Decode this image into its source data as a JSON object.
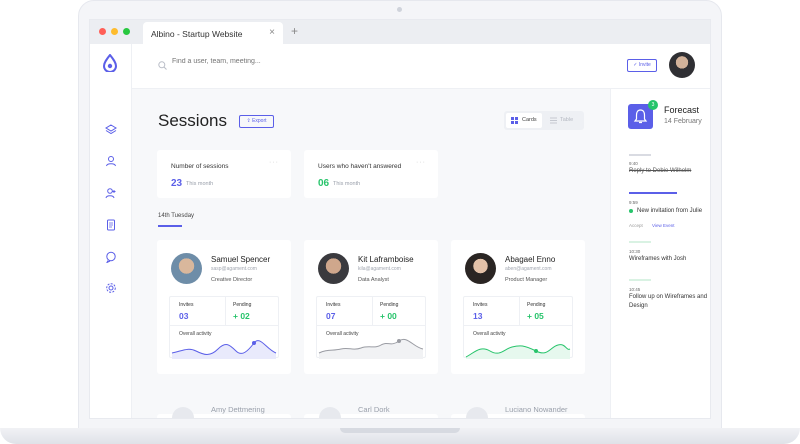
{
  "browser": {
    "tab_title": "Albino - Startup Website",
    "tab_close": "×",
    "new_tab": "+"
  },
  "topbar": {
    "search_placeholder": "Find a user, team, meeting...",
    "invite_label": "Invite"
  },
  "main": {
    "title": "Sessions",
    "export_label": "Export",
    "view_toggle": {
      "cards": "Cards",
      "table": "Table"
    },
    "stats": [
      {
        "label": "Number of sessions",
        "value": "23",
        "sub": "This month",
        "color": "#5b5fe8"
      },
      {
        "label": "Users  who haven't answered",
        "value": "06",
        "sub": "This month",
        "color": "#27c46b"
      }
    ],
    "date_label": "14th Tuesday",
    "cards": [
      {
        "name": "Samuel Spencer",
        "email": "sasp@agament.com",
        "role": "Creative Director",
        "invites_label": "Invites",
        "invites": "03",
        "pending_label": "Pending",
        "pending": "+ 02",
        "activity_label": "Overall activity",
        "chart_color": "#5b5fe8"
      },
      {
        "name": "Kit Laframboise",
        "email": "kila@agament.com",
        "role": "Data Analyst",
        "invites_label": "Invites",
        "invites": "07",
        "pending_label": "Pending",
        "pending": "+ 00",
        "activity_label": "Overall activity",
        "chart_color": "#9a9ca3"
      },
      {
        "name": "Abagael Enno",
        "email": "aben@agament.com",
        "role": "Product Manager",
        "invites_label": "Invites",
        "invites": "13",
        "pending_label": "Pending",
        "pending": "+ 05",
        "activity_label": "Overall activity",
        "chart_color": "#27c46b"
      }
    ],
    "next_cards": [
      "Amy Dettmering",
      "Carl Dork",
      "Luciano Nowander"
    ]
  },
  "panel": {
    "badge": "3",
    "title": "Forecast",
    "date": "14 February",
    "events": [
      {
        "time": "9:40",
        "text": "Reply to Debie Wilhelm",
        "done": true,
        "bar_color": "#d9dbe2"
      },
      {
        "time": "9:59",
        "text": "New invitation from Julie",
        "bar_color": "#5b5fe8",
        "actions": [
          "Accept",
          "View Event"
        ]
      },
      {
        "time": "10:30",
        "text": "Wireframes with Josh",
        "bar_color": "#d9f2e3"
      },
      {
        "time": "10:45",
        "text": "Follow up on Wireframes and Design",
        "bar_color": "#d9f2e3"
      }
    ]
  },
  "colors": {
    "accent": "#5b5fe8",
    "success": "#27c46b"
  }
}
